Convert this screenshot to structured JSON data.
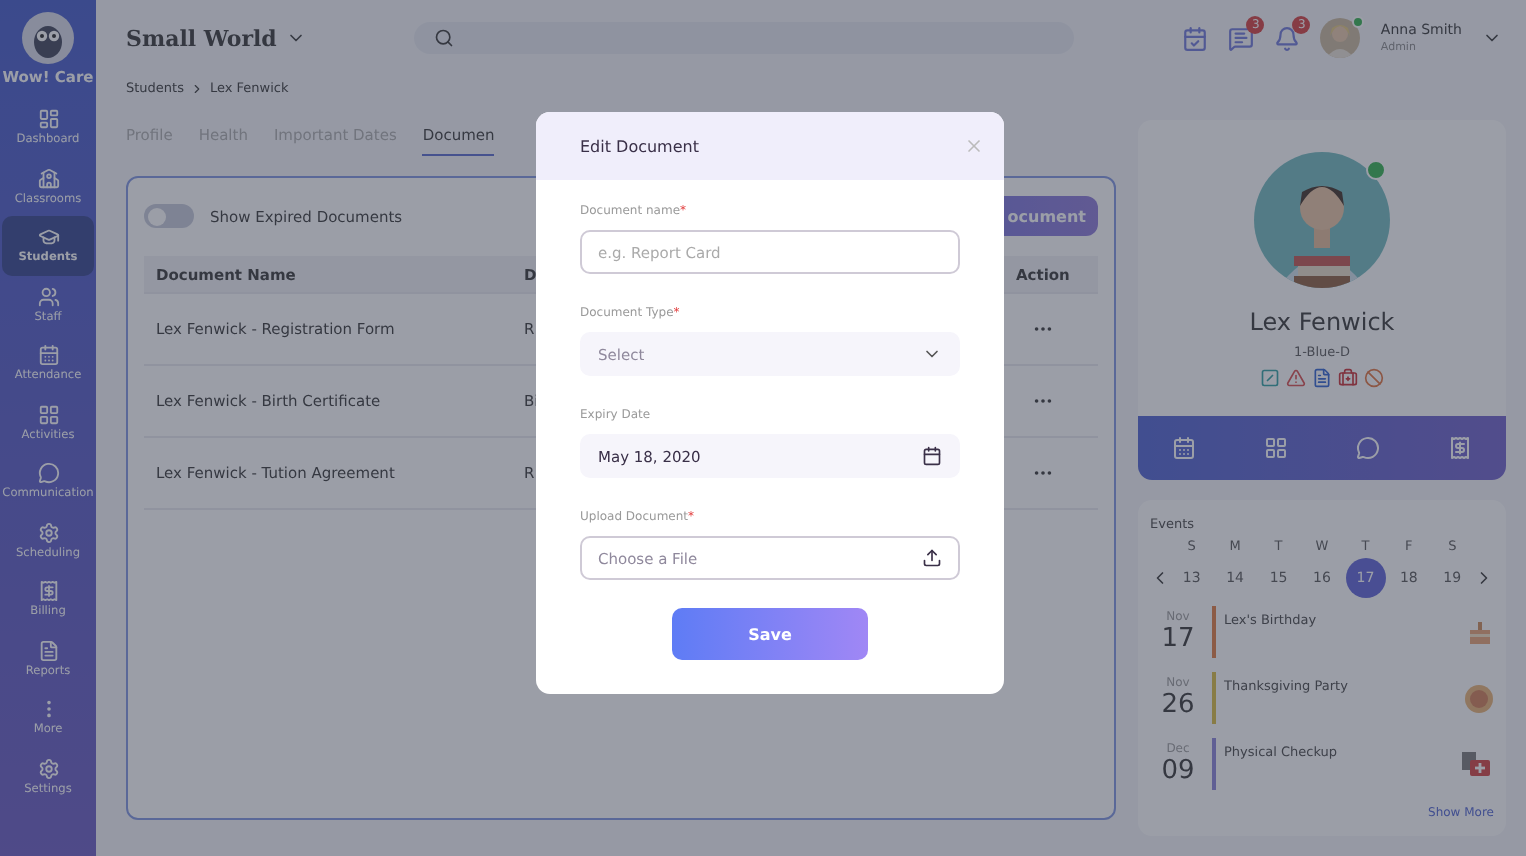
{
  "sidebar": {
    "logo_text": "Wow! Care",
    "items": [
      {
        "label": "Dashboard",
        "selected": false
      },
      {
        "label": "Classrooms",
        "selected": false
      },
      {
        "label": "Students",
        "selected": true
      },
      {
        "label": "Staff",
        "selected": false
      },
      {
        "label": "Attendance",
        "selected": false
      },
      {
        "label": "Activities",
        "selected": false
      },
      {
        "label": "Communication",
        "selected": false
      },
      {
        "label": "Scheduling",
        "selected": false
      },
      {
        "label": "Billing",
        "selected": false
      },
      {
        "label": "Reports",
        "selected": false
      },
      {
        "label": "More",
        "selected": false
      },
      {
        "label": "Settings",
        "selected": false
      }
    ]
  },
  "header": {
    "school": "Small World",
    "messages_badge": "3",
    "notifications_badge": "3",
    "user": {
      "name": "Anna Smith",
      "role": "Admin",
      "online": true
    }
  },
  "breadcrumb": [
    "Students",
    "Lex Fenwick"
  ],
  "tabs": [
    {
      "label": "Profile",
      "selected": false
    },
    {
      "label": "Health",
      "selected": false
    },
    {
      "label": "Important Dates",
      "selected": false
    },
    {
      "label": "Documen",
      "selected": true
    }
  ],
  "documents": {
    "show_expired": {
      "label": "Show Expired Documents",
      "on": false
    },
    "add_button": "ocument",
    "columns": [
      "Document Name",
      "D",
      "Action"
    ],
    "rows": [
      {
        "name": "Lex Fenwick - Registration Form",
        "column_2": "R"
      },
      {
        "name": "Lex Fenwick - Birth Certificate",
        "column_2": "Bi"
      },
      {
        "name": "Lex Fenwick - Tution Agreement",
        "column_2": "R"
      }
    ]
  },
  "student": {
    "name": "Lex Fenwick",
    "class": "1-Blue-D",
    "online": true
  },
  "events": {
    "title": "Events",
    "weekdays": [
      "S",
      "M",
      "T",
      "W",
      "T",
      "F",
      "S"
    ],
    "days": [
      {
        "label": "13",
        "selected": false
      },
      {
        "label": "14",
        "selected": false
      },
      {
        "label": "15",
        "selected": false
      },
      {
        "label": "16",
        "selected": false
      },
      {
        "label": "17",
        "selected": true
      },
      {
        "label": "18",
        "selected": false
      },
      {
        "label": "19",
        "selected": false
      }
    ],
    "items": [
      {
        "month": "Nov",
        "day": "17",
        "title": "Lex's Birthday",
        "color": "#8c5b46"
      },
      {
        "month": "Nov",
        "day": "26",
        "title": "Thanksgiving Party",
        "color": "#887c46"
      },
      {
        "month": "Dec",
        "day": "09",
        "title": "Physical Checkup",
        "color": "#605f94"
      }
    ],
    "show_more": "Show More"
  },
  "modal": {
    "title": "Edit Document",
    "fields": [
      {
        "kind": "text",
        "label": "Document name",
        "required_mark": "*",
        "placeholder": "e.g. Report Card"
      },
      {
        "kind": "select",
        "label": "Document Type",
        "required_mark": "*",
        "placeholder": "Select"
      },
      {
        "kind": "date",
        "label": "Expiry Date",
        "value": "May 18, 2020"
      },
      {
        "kind": "file",
        "label": "Upload Document",
        "required_mark": "*",
        "placeholder": "Choose a File"
      }
    ],
    "save": "Save"
  }
}
